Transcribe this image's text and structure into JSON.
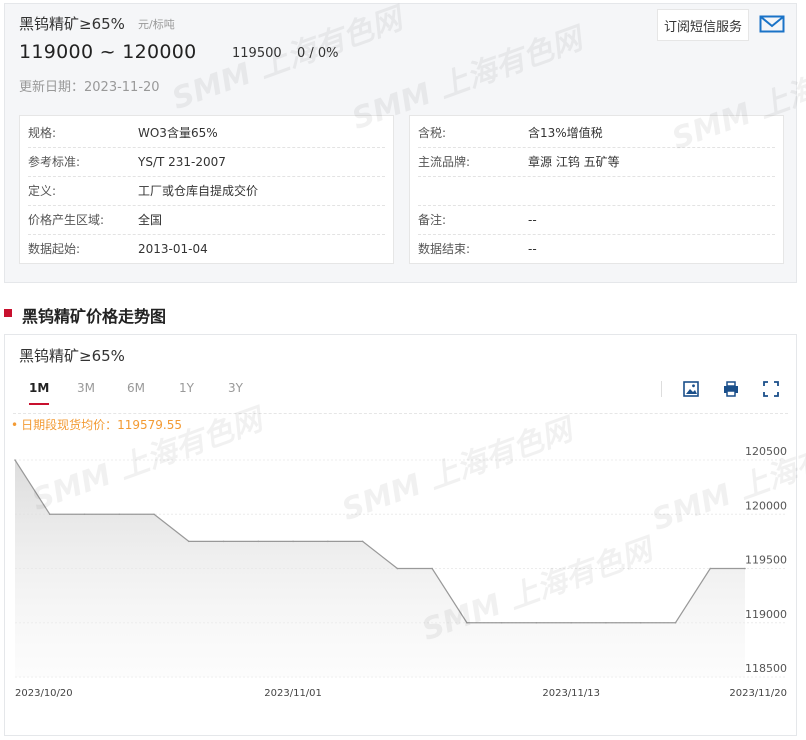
{
  "product": {
    "name": "黑钨精矿≥65%",
    "unit": "元/标吨",
    "price_range": "119000 ~ 120000",
    "avg_price": "119500",
    "change": "0 / 0%",
    "update_label": "更新日期：",
    "update_date": "2023-11-20",
    "sms_button": "订阅短信服务"
  },
  "specs_left": [
    {
      "label": "规格:",
      "value": "WO3含量65%"
    },
    {
      "label": "参考标准:",
      "value": "YS/T 231-2007"
    },
    {
      "label": "定义:",
      "value": "工厂或仓库自提成交价"
    },
    {
      "label": "价格产生区域:",
      "value": "全国"
    },
    {
      "label": "数据起始:",
      "value": "2013-01-04"
    }
  ],
  "specs_right": [
    {
      "label": "含税:",
      "value": "含13%增值税"
    },
    {
      "label": "主流品牌:",
      "value": "章源 江钨 五矿等"
    },
    {
      "label": "",
      "value": ""
    },
    {
      "label": "备注:",
      "value": "--"
    },
    {
      "label": "数据结束:",
      "value": "--"
    }
  ],
  "section_title": "黑钨精矿价格走势图",
  "chart_panel": {
    "title": "黑钨精矿≥65%",
    "tabs": [
      "1M",
      "3M",
      "6M",
      "1Y",
      "3Y"
    ],
    "active_tab": "1M",
    "avg_label": "日期段现货均价：119579.55"
  },
  "watermark": "SMM 上海有色网",
  "colors": {
    "accent": "#c8102e",
    "avg_label": "#f39b34",
    "line": "#999999"
  },
  "icons": {
    "sms": "mail-icon",
    "tools": [
      "download-image-icon",
      "print-icon",
      "fullscreen-icon"
    ]
  },
  "chart_data": {
    "type": "area",
    "x": [
      "2023/10/20",
      "2023/10/23",
      "2023/10/24",
      "2023/10/25",
      "2023/10/26",
      "2023/10/27",
      "2023/10/30",
      "2023/10/31",
      "2023/11/01",
      "2023/11/02",
      "2023/11/03",
      "2023/11/06",
      "2023/11/07",
      "2023/11/08",
      "2023/11/09",
      "2023/11/10",
      "2023/11/13",
      "2023/11/14",
      "2023/11/15",
      "2023/11/16",
      "2023/11/17",
      "2023/11/20"
    ],
    "values": [
      120500,
      120000,
      120000,
      120000,
      120000,
      119750,
      119750,
      119750,
      119750,
      119750,
      119750,
      119500,
      119500,
      119000,
      119000,
      119000,
      119000,
      119000,
      119000,
      119000,
      119500,
      119500
    ],
    "x_tick_labels": [
      "2023/10/20",
      "2023/11/01",
      "2023/11/13",
      "2023/11/20"
    ],
    "y_ticks": [
      118500,
      119000,
      119500,
      120000,
      120500
    ],
    "ylim": [
      118500,
      120500
    ],
    "title": "黑钨精矿≥65%",
    "xlabel": "",
    "ylabel": "",
    "legend": "none"
  }
}
